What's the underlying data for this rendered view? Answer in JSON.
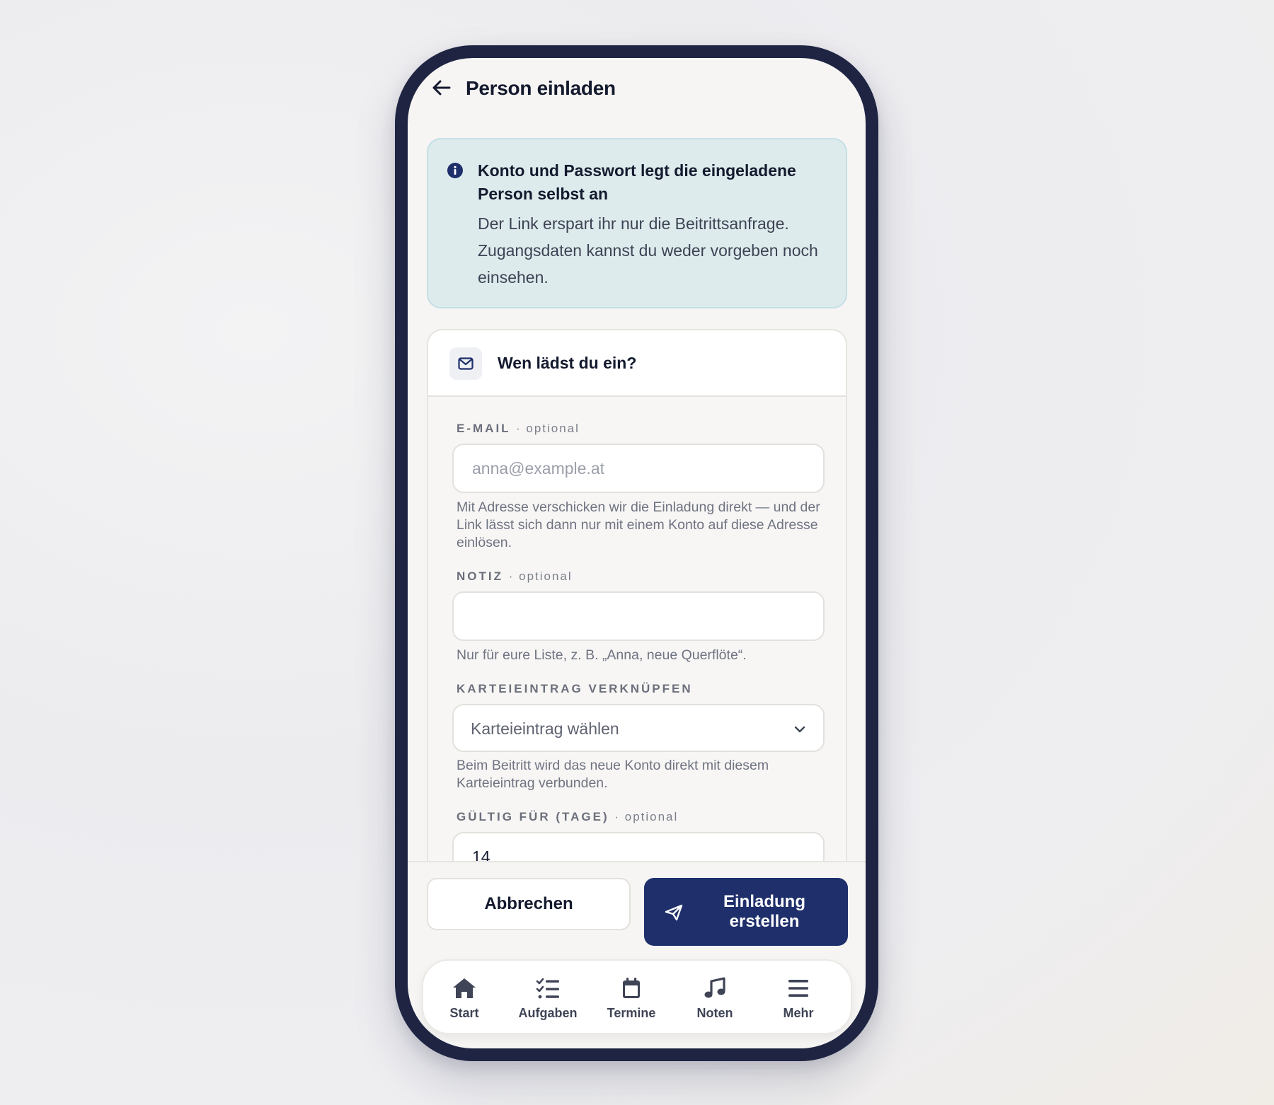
{
  "header": {
    "title": "Person einladen",
    "back_icon": "arrow-left-icon"
  },
  "callout": {
    "icon": "info-icon",
    "title": "Konto und Passwort legt die eingeladene Person selbst an",
    "body": "Der Link erspart ihr nur die Beitrittsanfrage. Zugangsdaten kannst du weder vorgeben noch einsehen."
  },
  "card": {
    "icon": "envelope-icon",
    "title": "Wen lädst du ein?"
  },
  "form": {
    "email": {
      "label": "E-MAIL",
      "optional": "·  optional",
      "placeholder": "anna@example.at",
      "value": "",
      "help": "Mit Adresse verschicken wir die Einladung direkt — und der Link lässt sich dann nur mit einem Konto auf diese Adresse einlösen."
    },
    "note": {
      "label": "NOTIZ",
      "optional": "·  optional",
      "value": "",
      "help": "Nur für eure Liste, z. B. „Anna, neue Querflöte“."
    },
    "entry": {
      "label": "KARTEIEINTRAG VERKNÜPFEN",
      "selected": "Karteieintrag wählen",
      "help": "Beim Beitritt wird das neue Konto direkt mit diesem Karteieintrag verbunden."
    },
    "validity": {
      "label": "GÜLTIG FÜR (TAGE)",
      "optional": "·  optional",
      "value": "14"
    }
  },
  "actions": {
    "cancel": "Abbrechen",
    "create": "Einladung erstellen",
    "create_icon": "send-icon"
  },
  "nav": {
    "items": [
      {
        "label": "Start",
        "icon": "home-icon"
      },
      {
        "label": "Aufgaben",
        "icon": "tasks-icon"
      },
      {
        "label": "Termine",
        "icon": "calendar-icon"
      },
      {
        "label": "Noten",
        "icon": "music-note-icon"
      },
      {
        "label": "Mehr",
        "icon": "menu-icon"
      }
    ]
  },
  "colors": {
    "frame": "#1e2442",
    "primary": "#1e2f6b",
    "callout_bg": "#ddebed",
    "callout_border": "#c4e0e6"
  }
}
